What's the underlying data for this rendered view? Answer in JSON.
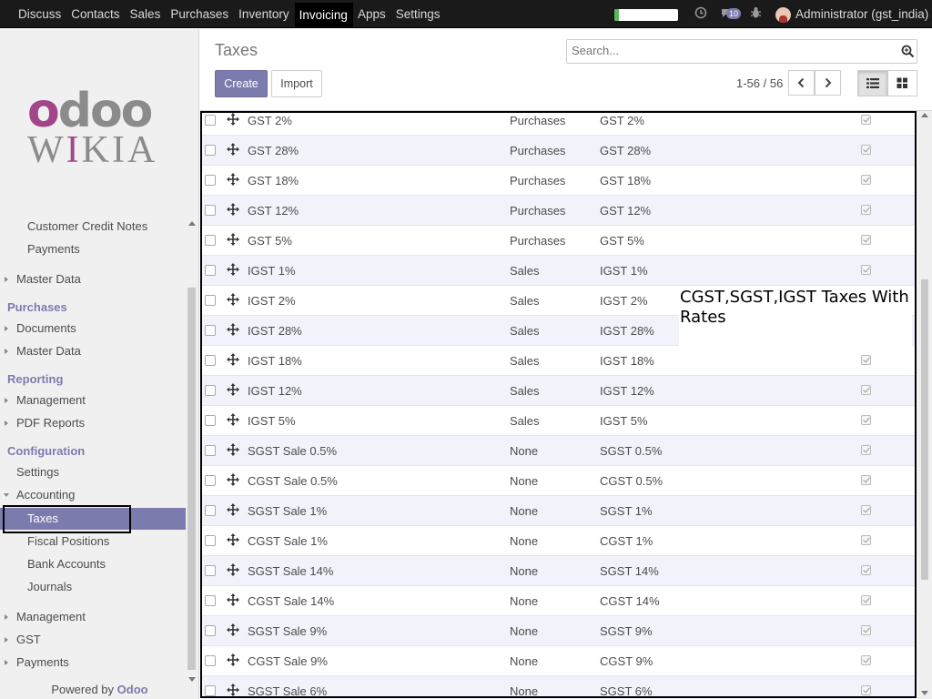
{
  "topbar": {
    "menu": [
      "Discuss",
      "Contacts",
      "Sales",
      "Purchases",
      "Inventory",
      "Invoicing",
      "Apps",
      "Settings"
    ],
    "active": "Invoicing",
    "message_count": "10",
    "user": "Administrator (gst_india)",
    "progress": 0.07,
    "icons": [
      "clock-icon",
      "chat-icon",
      "bug-icon"
    ]
  },
  "sidebar": {
    "logo_top": "odoo",
    "logo_bottom": "WIKIA",
    "items": [
      {
        "label": "Customer Credit Notes",
        "kind": "sub"
      },
      {
        "label": "Payments",
        "kind": "sub"
      },
      {
        "label": "Master Data",
        "kind": "group"
      },
      {
        "label": "Purchases",
        "kind": "head"
      },
      {
        "label": "Documents",
        "kind": "group"
      },
      {
        "label": "Master Data",
        "kind": "group"
      },
      {
        "label": "Reporting",
        "kind": "head"
      },
      {
        "label": "Management",
        "kind": "group"
      },
      {
        "label": "PDF Reports",
        "kind": "group"
      },
      {
        "label": "Configuration",
        "kind": "head"
      },
      {
        "label": "Settings",
        "kind": "plain"
      },
      {
        "label": "Accounting",
        "kind": "open"
      },
      {
        "label": "Taxes",
        "kind": "active"
      },
      {
        "label": "Fiscal Positions",
        "kind": "sub"
      },
      {
        "label": "Bank Accounts",
        "kind": "sub"
      },
      {
        "label": "Journals",
        "kind": "sub"
      },
      {
        "label": "Management",
        "kind": "group"
      },
      {
        "label": "GST",
        "kind": "group"
      },
      {
        "label": "Payments",
        "kind": "group"
      }
    ],
    "powered_prefix": "Powered by ",
    "powered_brand": "Odoo"
  },
  "control_panel": {
    "title": "Taxes",
    "search_placeholder": "Search...",
    "create_label": "Create",
    "import_label": "Import",
    "pager": "1-56 / 56"
  },
  "annotation": "CGST,SGST,IGST Taxes With Rates",
  "rows": [
    {
      "name": "GST 2%",
      "scope": "Purchases",
      "label": "GST 2%"
    },
    {
      "name": "GST 28%",
      "scope": "Purchases",
      "label": "GST 28%"
    },
    {
      "name": "GST 18%",
      "scope": "Purchases",
      "label": "GST 18%"
    },
    {
      "name": "GST 12%",
      "scope": "Purchases",
      "label": "GST 12%"
    },
    {
      "name": "GST 5%",
      "scope": "Purchases",
      "label": "GST 5%"
    },
    {
      "name": "IGST 1%",
      "scope": "Sales",
      "label": "IGST 1%"
    },
    {
      "name": "IGST 2%",
      "scope": "Sales",
      "label": "IGST 2%"
    },
    {
      "name": "IGST 28%",
      "scope": "Sales",
      "label": "IGST 28%"
    },
    {
      "name": "IGST 18%",
      "scope": "Sales",
      "label": "IGST 18%"
    },
    {
      "name": "IGST 12%",
      "scope": "Sales",
      "label": "IGST 12%"
    },
    {
      "name": "IGST 5%",
      "scope": "Sales",
      "label": "IGST 5%"
    },
    {
      "name": "SGST Sale 0.5%",
      "scope": "None",
      "label": "SGST 0.5%"
    },
    {
      "name": "CGST Sale 0.5%",
      "scope": "None",
      "label": "CGST 0.5%"
    },
    {
      "name": "SGST Sale 1%",
      "scope": "None",
      "label": "SGST 1%"
    },
    {
      "name": "CGST Sale 1%",
      "scope": "None",
      "label": "CGST 1%"
    },
    {
      "name": "SGST Sale 14%",
      "scope": "None",
      "label": "SGST 14%"
    },
    {
      "name": "CGST Sale 14%",
      "scope": "None",
      "label": "CGST 14%"
    },
    {
      "name": "SGST Sale 9%",
      "scope": "None",
      "label": "SGST 9%"
    },
    {
      "name": "CGST Sale 9%",
      "scope": "None",
      "label": "CGST 9%"
    },
    {
      "name": "SGST Sale 6%",
      "scope": "None",
      "label": "SGST 6%"
    }
  ]
}
